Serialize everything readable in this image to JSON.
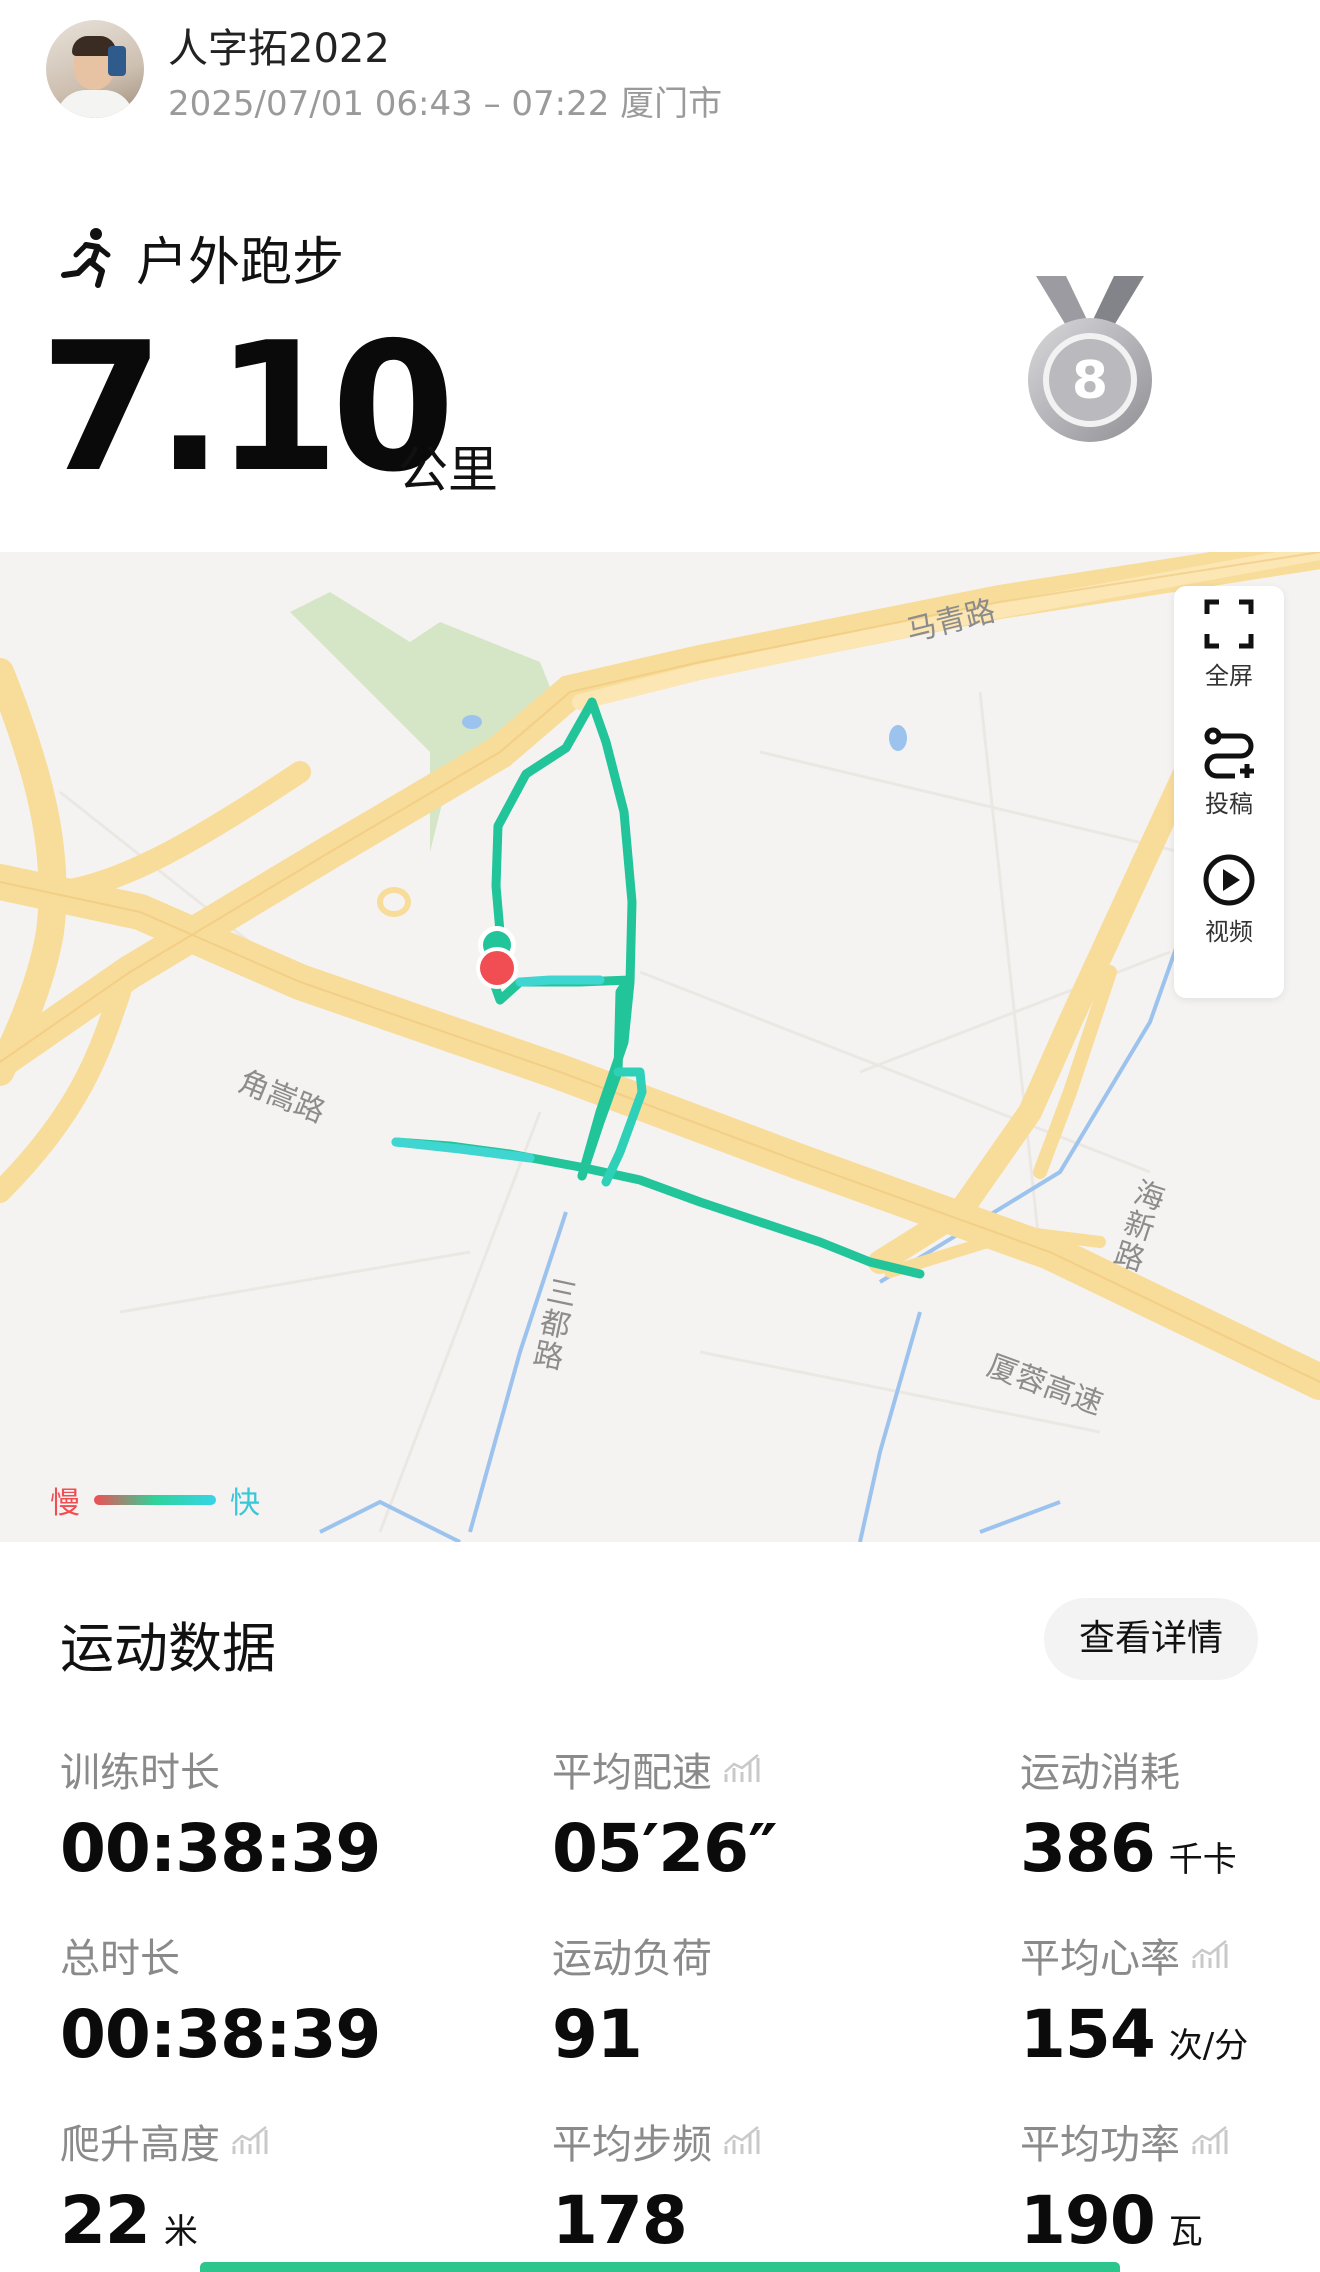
{
  "header": {
    "username": "人字拓2022",
    "datetime": "2025/07/01 06:43 – 07:22 厦门市"
  },
  "activity": {
    "sport_type": "户外跑步",
    "sport_icon": "running-person-icon",
    "distance": "7.10",
    "distance_unit": "公里",
    "medal_number": "8",
    "medal_icon": "medal-icon"
  },
  "map": {
    "road_labels": {
      "maqing": "马青路",
      "jiaosong": "角嵩路",
      "sandu": "三都路",
      "haixin": "海新路",
      "xiarong": "厦蓉高速"
    },
    "controls": {
      "fullscreen": "全屏",
      "submit": "投稿",
      "video": "视频"
    },
    "legend": {
      "slow": "慢",
      "fast": "快"
    },
    "colors": {
      "route": "#22c49a",
      "start_marker": "#f04e52",
      "road": "#f8dc9a"
    }
  },
  "stats": {
    "title": "运动数据",
    "details_button": "查看详情",
    "items": [
      {
        "label": "训练时长",
        "value": "00:38:39",
        "unit": ""
      },
      {
        "label": "平均配速",
        "value": "05′26″",
        "unit": ""
      },
      {
        "label": "运动消耗",
        "value": "386",
        "unit": "千卡"
      },
      {
        "label": "总时长",
        "value": "00:38:39",
        "unit": ""
      },
      {
        "label": "运动负荷",
        "value": "91",
        "unit": ""
      },
      {
        "label": "平均心率",
        "value": "154",
        "unit": "次/分"
      },
      {
        "label": "爬升高度",
        "value": "22",
        "unit": "米"
      },
      {
        "label": "平均步频",
        "value": "178",
        "unit": ""
      },
      {
        "label": "平均功率",
        "value": "190",
        "unit": "瓦"
      }
    ]
  }
}
